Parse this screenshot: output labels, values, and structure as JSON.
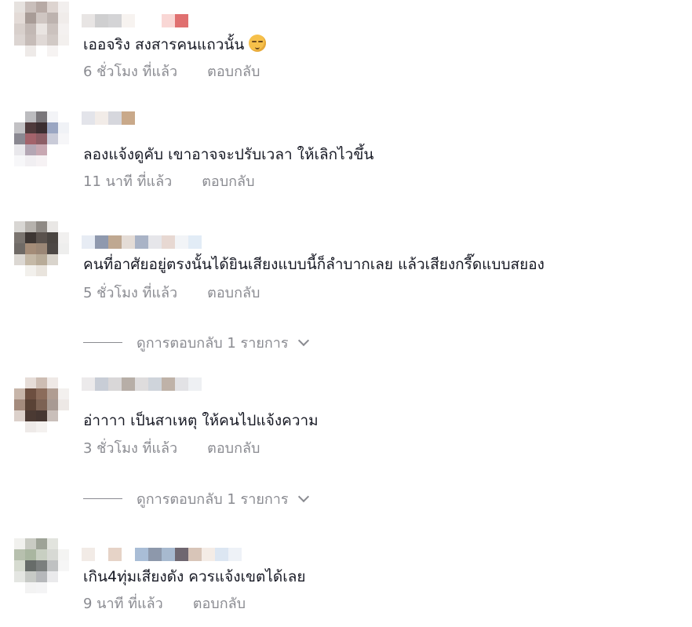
{
  "comments": [
    {
      "text": "เออจริง สงสารคนแถวนั้น",
      "emoji": "relieved-face-emoji",
      "time": "6 ชั่วโมง ที่แล้ว",
      "reply_label": "ตอบกลับ",
      "avatar_colors": [
        "#e6e2df",
        "#c9bfbb",
        "#b7aaa5",
        "#ddd4d0",
        "#f2efee",
        "#e3dbd7",
        "#a89c97",
        "#cfc6c2",
        "#bdb3af",
        "#f0ecea",
        "#d8d0cc",
        "#c2b8b4",
        "#e9e4e1",
        "#cbc2be",
        "#f4f1f0",
        "#dcd5d2",
        "#c6bcb8",
        "#e0d9d6",
        "#d1c9c5",
        "#f3f0ee",
        "#ffffff",
        "#eeeae8",
        "#ffffff",
        "#f6f3f2",
        "#ffffff"
      ],
      "username_colors": [
        "#e8e5e4",
        "#cfcfd0",
        "#d4d4d6",
        "#f7f3f0",
        "#ffffff",
        "#ffffff",
        "#f9d7d5",
        "#e07070"
      ]
    },
    {
      "text": "ลองแจ้งดูคับ เขาอาจจะปรับเวลา ให้เลิกไวขึ้น",
      "time": "11 นาที ที่แล้ว",
      "reply_label": "ตอบกลับ",
      "avatar_colors": [
        "#ffffff",
        "#bcbcbf",
        "#7a777b",
        "#f3f4f7",
        "#ffffff",
        "#c2c1c4",
        "#4f3a3c",
        "#3b2e31",
        "#9aa6c2",
        "#f0f2f6",
        "#8a8891",
        "#a3636b",
        "#8c5e66",
        "#c9cbd8",
        "#f6f6f8",
        "#e9e8ec",
        "#b4a7b4",
        "#c8a8b2",
        "#ffffff",
        "#ffffff",
        "#f7f7f9",
        "#f1eff2",
        "#f6f2f4",
        "#ffffff",
        "#ffffff"
      ],
      "username_colors": [
        "#e3e4ea",
        "#f2ece8",
        "#d6d7dd",
        "#c9a98a"
      ]
    },
    {
      "text": "คนที่อาศัยอยู่ตรงนั้นได้ยินเสียงแบบนี้ก็ลำบากเลย แล้วเสียงกรี๊ดแบบสยอง",
      "time": "5 ชั่วโมง ที่แล้ว",
      "reply_label": "ตอบกลับ",
      "view_replies": "ดูการตอบกลับ 1 รายการ",
      "avatar_colors": [
        "#d8d6d3",
        "#b6b2ad",
        "#8f8a85",
        "#e9e7e5",
        "#ffffff",
        "#7a746f",
        "#3d3633",
        "#5a524d",
        "#4a4541",
        "#f1f0ef",
        "#6f6a66",
        "#a48c78",
        "#9b8776",
        "#4d4845",
        "#eeeeed",
        "#dcd8d3",
        "#c5b9a7",
        "#b8ab98",
        "#d9d4cc",
        "#ffffff",
        "#ffffff",
        "#f2f0ec",
        "#e9e4dd",
        "#ffffff",
        "#ffffff"
      ],
      "username_colors": [
        "#e7ecf4",
        "#8f99ae",
        "#bfa891",
        "#e4dcd6",
        "#a9b3c6",
        "#e6e6ea",
        "#e7d8d2",
        "#f2f4f7",
        "#e2ecf6"
      ]
    },
    {
      "text": "อ่าาาา เป็นสาเหตุ ให้คนไปแจ้งความ",
      "time": "3 ชั่วโมง ที่แล้ว",
      "reply_label": "ตอบกลับ",
      "view_replies": "ดูการตอบกลับ 1 รายการ",
      "avatar_colors": [
        "#ffffff",
        "#e6ddd8",
        "#cdbdb3",
        "#efe9e6",
        "#ffffff",
        "#c7b5a9",
        "#6d4f40",
        "#8b6c5b",
        "#b09d92",
        "#f3f0ee",
        "#a48b7d",
        "#5a4236",
        "#7c6254",
        "#a89a93",
        "#ede8e5",
        "#dcd1cb",
        "#4b3a33",
        "#463732",
        "#c9bfba",
        "#ffffff",
        "#ffffff",
        "#eeeae8",
        "#f4f1ef",
        "#ffffff",
        "#ffffff"
      ],
      "username_colors": [
        "#eceaeb",
        "#c8cdd6",
        "#d9d7d8",
        "#b7aea7",
        "#dedcdd",
        "#cfd4db",
        "#bfb2a8",
        "#e2e2e5",
        "#eef0f3"
      ]
    },
    {
      "text": "เกิน4ทุ่มเสียงดัง ควรแจ้งเขตได้เลย",
      "time": "9 นาที ที่แล้ว",
      "reply_label": "ตอบกลับ",
      "avatar_colors": [
        "#f1f1ee",
        "#c9cbc3",
        "#9ea397",
        "#e2e4de",
        "#ffffff",
        "#b7c0ae",
        "#a9b6a0",
        "#c8cfc2",
        "#d7d9d4",
        "#f4f4f2",
        "#d6dbd0",
        "#676c69",
        "#7b7f7e",
        "#bfc1c2",
        "#f6f6f6",
        "#e4e6e2",
        "#c7cac6",
        "#b6b8bb",
        "#eaeaec",
        "#ffffff",
        "#ffffff",
        "#f3f3f3",
        "#f4f4f5",
        "#ffffff",
        "#ffffff"
      ],
      "username_colors": [
        "#f2ebe6",
        "#ffffff",
        "#e6d3c7",
        "#ffffff",
        "#a9bdd6",
        "#8d98ab",
        "#a7b9cf",
        "#6f6770",
        "#d8c5b8",
        "#f4ece6",
        "#dce6f2",
        "#eef2f7"
      ]
    }
  ]
}
